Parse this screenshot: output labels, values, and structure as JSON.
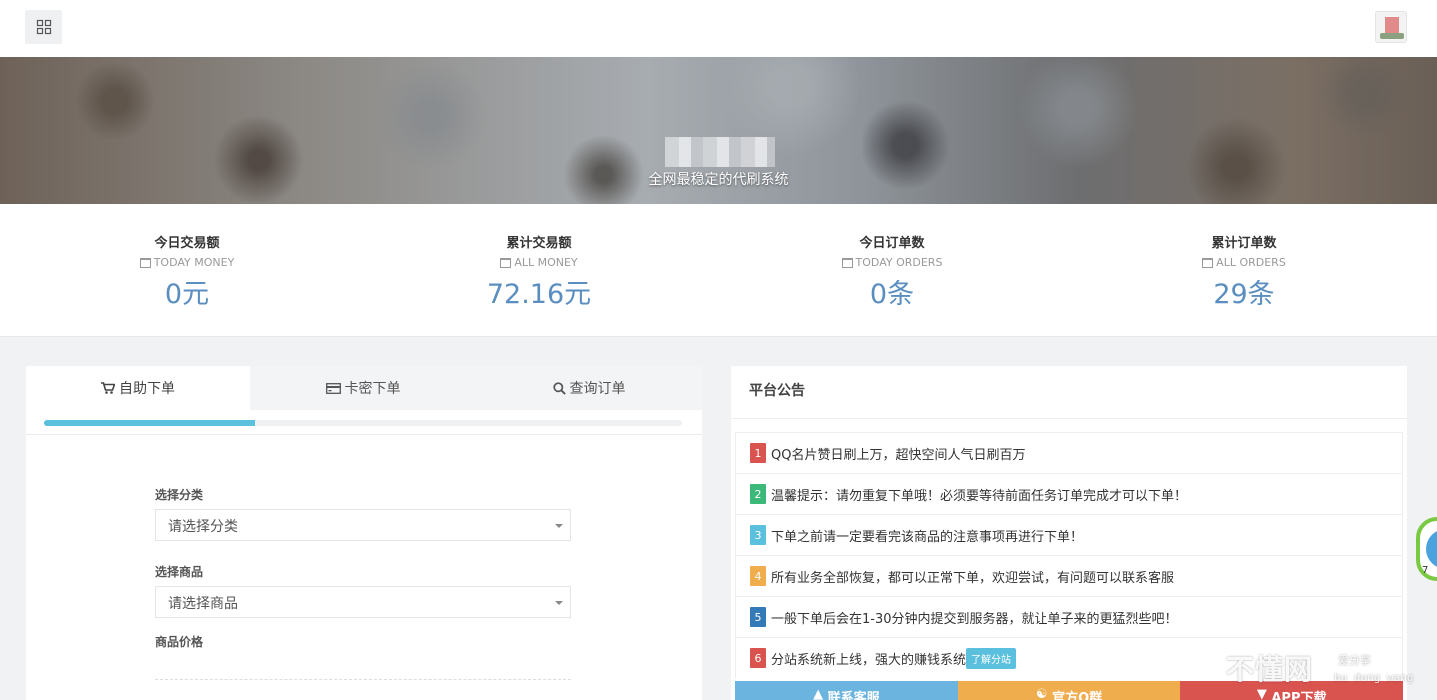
{
  "banner": {
    "slogan": "全网最稳定的代刷系统"
  },
  "stats": [
    {
      "label": "今日交易额",
      "sub": "TODAY MONEY",
      "value": "0元"
    },
    {
      "label": "累计交易额",
      "sub": "ALL MONEY",
      "value": "72.16元"
    },
    {
      "label": "今日订单数",
      "sub": "TODAY ORDERS",
      "value": "0条"
    },
    {
      "label": "累计订单数",
      "sub": "ALL ORDERS",
      "value": "29条"
    }
  ],
  "tabs": [
    {
      "label": "自助下单",
      "icon": "cart-icon"
    },
    {
      "label": "卡密下单",
      "icon": "card-icon"
    },
    {
      "label": "查询订单",
      "icon": "search-icon"
    }
  ],
  "progress": {
    "percent": 33
  },
  "form": {
    "category_label": "选择分类",
    "category_value": "请选择分类",
    "product_label": "选择商品",
    "product_value": "请选择商品",
    "price_label": "商品价格"
  },
  "notice": {
    "title": "平台公告",
    "items": [
      {
        "num": "1",
        "text": "QQ名片赞日刷上万，超快空间人气日刷百万",
        "color": "#d9534f"
      },
      {
        "num": "2",
        "text": "温馨提示：请勿重复下单哦！必须要等待前面任务订单完成才可以下单！",
        "color": "#3cb878"
      },
      {
        "num": "3",
        "text": "下单之前请一定要看完该商品的注意事项再进行下单！",
        "color": "#5bc0de"
      },
      {
        "num": "4",
        "text": "所有业务全部恢复，都可以正常下单，欢迎尝试，有问题可以联系客服",
        "color": "#f0ad4e"
      },
      {
        "num": "5",
        "text": "一般下单后会在1-30分钟内提交到服务器，就让单子来的更猛烈些吧！",
        "color": "#337ab7"
      },
      {
        "num": "6",
        "text": "分站系统新上线，强大的赚钱系统",
        "color": "#d9534f",
        "tag": "了解分站"
      }
    ],
    "buttons": [
      {
        "label": "联系客服",
        "color": "#6cb4e0"
      },
      {
        "label": "官方Q群",
        "color": "#f0ad4e"
      },
      {
        "label": "APP下载",
        "color": "#d9534f"
      }
    ]
  },
  "float": {
    "value": "7"
  },
  "watermark": {
    "main": "不懂网",
    "side": "爱分享",
    "pinyin": "bu dong wang"
  }
}
